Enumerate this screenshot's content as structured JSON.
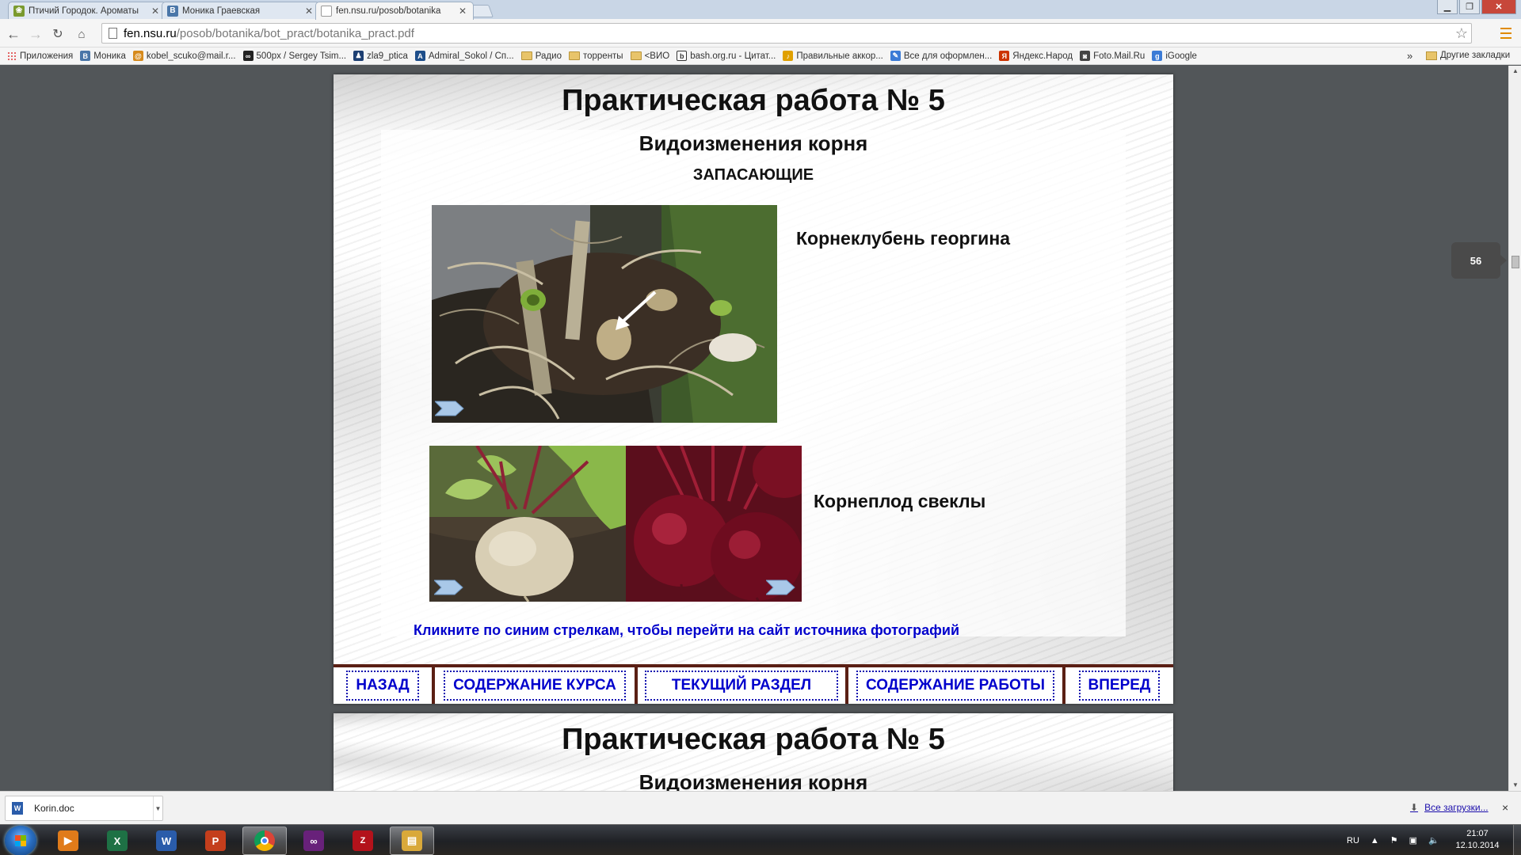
{
  "browser": {
    "tabs": [
      {
        "title": "Птичий Городок. Ароматы",
        "icon": "bird-icon",
        "color": "#7a9a2e",
        "active": false
      },
      {
        "title": "Моника Граевская",
        "icon": "vk-icon",
        "color": "#4a76a8",
        "active": false
      },
      {
        "title": "fen.nsu.ru/posob/botanika",
        "icon": "page-icon",
        "color": "#ffffff",
        "active": true
      }
    ],
    "new_tab_icon": "new-tab-icon",
    "url_host": "fen.nsu.ru",
    "url_path": "/posob/botanika/bot_pract/botanika_pract.pdf"
  },
  "bookmarks": {
    "items": [
      {
        "label": "Приложения",
        "icon": "apps-grid-icon",
        "kind": "apps"
      },
      {
        "label": "Моника",
        "icon": "vk-icon",
        "kind": "site",
        "color": "#4a76a8",
        "glyph": "В"
      },
      {
        "label": "kobel_scuko@mail.r...",
        "icon": "mail-at-icon",
        "kind": "site",
        "color": "#d68a1c",
        "glyph": "@"
      },
      {
        "label": "500px / Sergey Tsim...",
        "icon": "infinity-icon",
        "kind": "site",
        "color": "#222222",
        "glyph": "∞"
      },
      {
        "label": "zla9_ptica",
        "icon": "user-icon",
        "kind": "site",
        "color": "#1d3f72",
        "glyph": "♟"
      },
      {
        "label": "Admiral_Sokol / Сп...",
        "icon": "site-icon",
        "kind": "site",
        "color": "#1d4e8a",
        "glyph": "A"
      },
      {
        "label": "Радио",
        "icon": "folder-icon",
        "kind": "folder"
      },
      {
        "label": "торренты",
        "icon": "folder-icon",
        "kind": "folder"
      },
      {
        "label": "<ВИО",
        "icon": "folder-icon",
        "kind": "folder"
      },
      {
        "label": "bash.org.ru - Цитат...",
        "icon": "bash-icon",
        "kind": "site",
        "color": "#333333",
        "glyph": "b"
      },
      {
        "label": "Правильные аккор...",
        "icon": "music-note-icon",
        "kind": "site",
        "color": "#e0a000",
        "glyph": "♪"
      },
      {
        "label": "Все для оформлен...",
        "icon": "site-icon",
        "kind": "site",
        "color": "#3b7bd6",
        "glyph": "✎"
      },
      {
        "label": "Яндекс.Народ",
        "icon": "yandex-icon",
        "kind": "site",
        "color": "#cc3300",
        "glyph": "Я"
      },
      {
        "label": "Foto.Mail.Ru",
        "icon": "camera-icon",
        "kind": "site",
        "color": "#444444",
        "glyph": "◙"
      },
      {
        "label": "iGoogle",
        "icon": "google-icon",
        "kind": "site",
        "color": "#3b7bd6",
        "glyph": "g"
      }
    ],
    "more": "»",
    "other": "Другие закладки"
  },
  "pdf": {
    "page_title": "Практическая работа № 5",
    "subtitle": "Видоизменения корня",
    "section": "ЗАПАСАЮЩИЕ",
    "caption_dahlia": "Корнеклубень георгина",
    "caption_beet": "Корнеплод свеклы",
    "note": "Кликните по синим стрелкам, чтобы перейти на сайт источника фотографий",
    "nav": {
      "back": "НАЗАД",
      "course_contents": "СОДЕРЖАНИЕ КУРСА",
      "current_section": "ТЕКУЩИЙ РАЗДЕЛ",
      "work_contents": "СОДЕРЖАНИЕ РАБОТЫ",
      "forward": "ВПЕРЕД"
    },
    "page_number": "56",
    "next_page_title": "Практическая работа № 5",
    "next_page_subtitle": "Видоизменения корня"
  },
  "downloads": {
    "file": "Korin.doc",
    "all_downloads": "Все загрузки...",
    "close": "×"
  },
  "taskbar": {
    "apps": [
      {
        "name": "media-player",
        "icon": "media-player-icon",
        "color": "#e07b1a",
        "glyph": "▶",
        "active": false
      },
      {
        "name": "excel",
        "icon": "excel-icon",
        "color": "#1e7145",
        "glyph": "X",
        "active": false
      },
      {
        "name": "word",
        "icon": "word-icon",
        "color": "#2a5caa",
        "glyph": "W",
        "active": false
      },
      {
        "name": "powerpoint",
        "icon": "powerpoint-icon",
        "color": "#c43e1c",
        "glyph": "P",
        "active": false
      },
      {
        "name": "chrome",
        "icon": "chrome-icon",
        "color": "#2f9e44",
        "glyph": "◉",
        "active": true
      },
      {
        "name": "visual-studio",
        "icon": "visual-studio-icon",
        "color": "#68217a",
        "glyph": "∞",
        "active": false
      },
      {
        "name": "zynga",
        "icon": "zynga-icon",
        "color": "#b3121b",
        "glyph": "Z",
        "active": false
      },
      {
        "name": "explorer",
        "icon": "folder-explorer-icon",
        "color": "#d9a93a",
        "glyph": "▤",
        "active": false
      }
    ],
    "language": "RU",
    "time": "21:07",
    "date": "12.10.2014"
  }
}
